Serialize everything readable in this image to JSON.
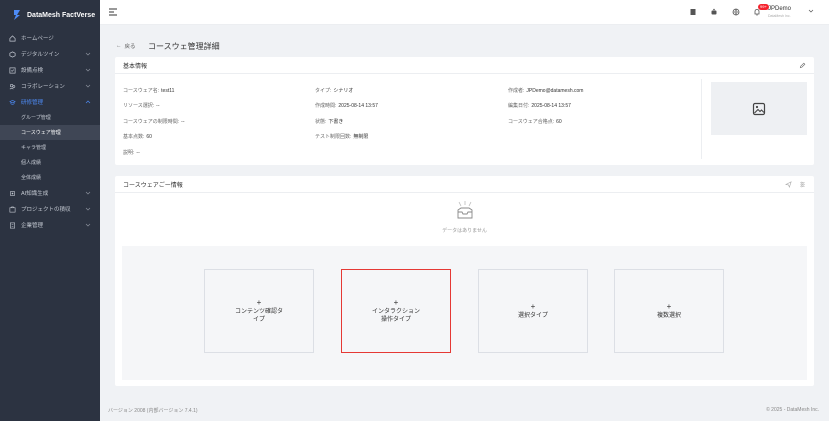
{
  "app": {
    "brand": "DataMesh FactVerse"
  },
  "sidebar": {
    "items": [
      {
        "label": "ホームページ",
        "icon": "home-icon",
        "has_chevron": false
      },
      {
        "label": "デジタルツイン",
        "icon": "cube-icon",
        "has_chevron": true
      },
      {
        "label": "設備点検",
        "icon": "inspection-icon",
        "has_chevron": true
      },
      {
        "label": "コラボレーション",
        "icon": "collab-icon",
        "has_chevron": true
      },
      {
        "label": "研修管理",
        "icon": "training-icon",
        "has_chevron": true,
        "active": true
      }
    ],
    "sub_items": [
      {
        "label": "グループ管理"
      },
      {
        "label": "コースウェア管理",
        "active": true
      },
      {
        "label": "キャラ管理"
      },
      {
        "label": "個人成績"
      },
      {
        "label": "全体成績"
      }
    ],
    "items_after": [
      {
        "label": "AI知識生成",
        "icon": "ai-icon",
        "has_chevron": true
      },
      {
        "label": "プロジェクトの積収",
        "icon": "project-icon",
        "has_chevron": true
      },
      {
        "label": "企業管理",
        "icon": "company-icon",
        "has_chevron": true
      }
    ]
  },
  "header": {
    "badge": "99+",
    "user_name": "JPDemo",
    "user_sub": "DataMesh Inc."
  },
  "page": {
    "back_label": "戻る",
    "title": "コースウェ管理詳細"
  },
  "basic_info": {
    "title": "基本情報",
    "fields": [
      {
        "label": "コースウェア名",
        "value": "test11"
      },
      {
        "label": "タイプ",
        "value": "シナリオ"
      },
      {
        "label": "作成者",
        "value": "JPDemo@datamesh.com"
      },
      {
        "label": "リソース選択",
        "value": "--"
      },
      {
        "label": "作成時間",
        "value": "2025-08-14 13:57"
      },
      {
        "label": "編集日付",
        "value": "2025-08-14 13:57"
      },
      {
        "label": "コースウェアの制限時間",
        "value": "--"
      },
      {
        "label": "状態",
        "value": "下書き"
      },
      {
        "label": "コースウェア合格点",
        "value": "60"
      },
      {
        "label": "基本点数",
        "value": "60"
      },
      {
        "label": "テスト制限回数",
        "value": "無制限"
      },
      {
        "label": "説明",
        "value": "--"
      }
    ]
  },
  "page_info": {
    "title": "コースウェアごー情報",
    "empty_text": "データはありません",
    "types": [
      {
        "label": "コンテンツ確認タ\nイプ",
        "selected": false
      },
      {
        "label": "インタラクション\n操作タイプ",
        "selected": true
      },
      {
        "label": "選択タイプ",
        "selected": false
      },
      {
        "label": "複数選択",
        "selected": false
      }
    ]
  },
  "footer": {
    "version": "バージョン 2008 (内部バージョン 7.4.1)",
    "copyright": "© 2025 - DataMesh Inc."
  },
  "colors": {
    "sidebar_bg": "#2c3341",
    "active": "#4e8cf7",
    "highlight": "#e53935"
  }
}
